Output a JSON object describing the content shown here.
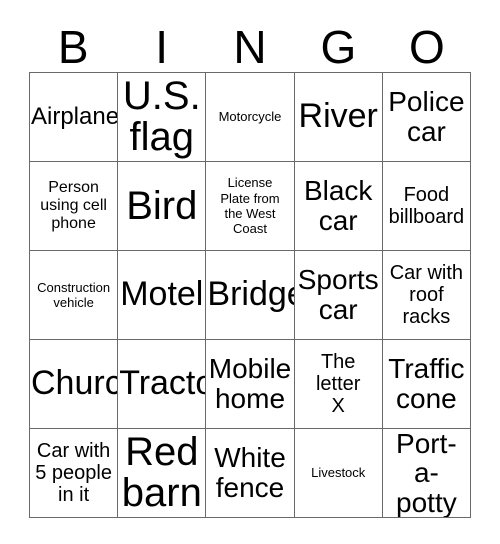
{
  "card": {
    "title_letters": [
      "B",
      "I",
      "N",
      "G",
      "O"
    ],
    "columns": 5,
    "rows": 5,
    "border_color": "#6a6a6a",
    "background_color": "#ffffff",
    "text_color": "#000000",
    "cells": [
      {
        "text": "Airplane",
        "size": "fs-l"
      },
      {
        "text": "U.S.\nflag",
        "size": "fs-3xl"
      },
      {
        "text": "Motorcycle",
        "size": "fs-xs"
      },
      {
        "text": "River",
        "size": "fs-xxl"
      },
      {
        "text": "Police\ncar",
        "size": "fs-xl"
      },
      {
        "text": "Person\nusing cell\nphone",
        "size": "fs-s"
      },
      {
        "text": "Bird",
        "size": "fs-3xl"
      },
      {
        "text": "License\nPlate from\nthe West\nCoast",
        "size": "fs-xs"
      },
      {
        "text": "Black\ncar",
        "size": "fs-xl"
      },
      {
        "text": "Food\nbillboard",
        "size": "fs-m"
      },
      {
        "text": "Construction\nvehicle",
        "size": "fs-xs"
      },
      {
        "text": "Motel",
        "size": "fs-xxl"
      },
      {
        "text": "Bridge",
        "size": "fs-xxl"
      },
      {
        "text": "Sports\ncar",
        "size": "fs-xl"
      },
      {
        "text": "Car with\nroof\nracks",
        "size": "fs-m"
      },
      {
        "text": "Church",
        "size": "fs-xxl"
      },
      {
        "text": "Tractor",
        "size": "fs-xxl"
      },
      {
        "text": "Mobile\nhome",
        "size": "fs-xl"
      },
      {
        "text": "The\nletter\nX",
        "size": "fs-m"
      },
      {
        "text": "Traffic\ncone",
        "size": "fs-xl"
      },
      {
        "text": "Car with\n5 people\nin it",
        "size": "fs-m"
      },
      {
        "text": "Red\nbarn",
        "size": "fs-3xl"
      },
      {
        "text": "White\nfence",
        "size": "fs-xl"
      },
      {
        "text": "Livestock",
        "size": "fs-xs"
      },
      {
        "text": "Port-a-\npotty",
        "size": "fs-xl"
      }
    ]
  }
}
